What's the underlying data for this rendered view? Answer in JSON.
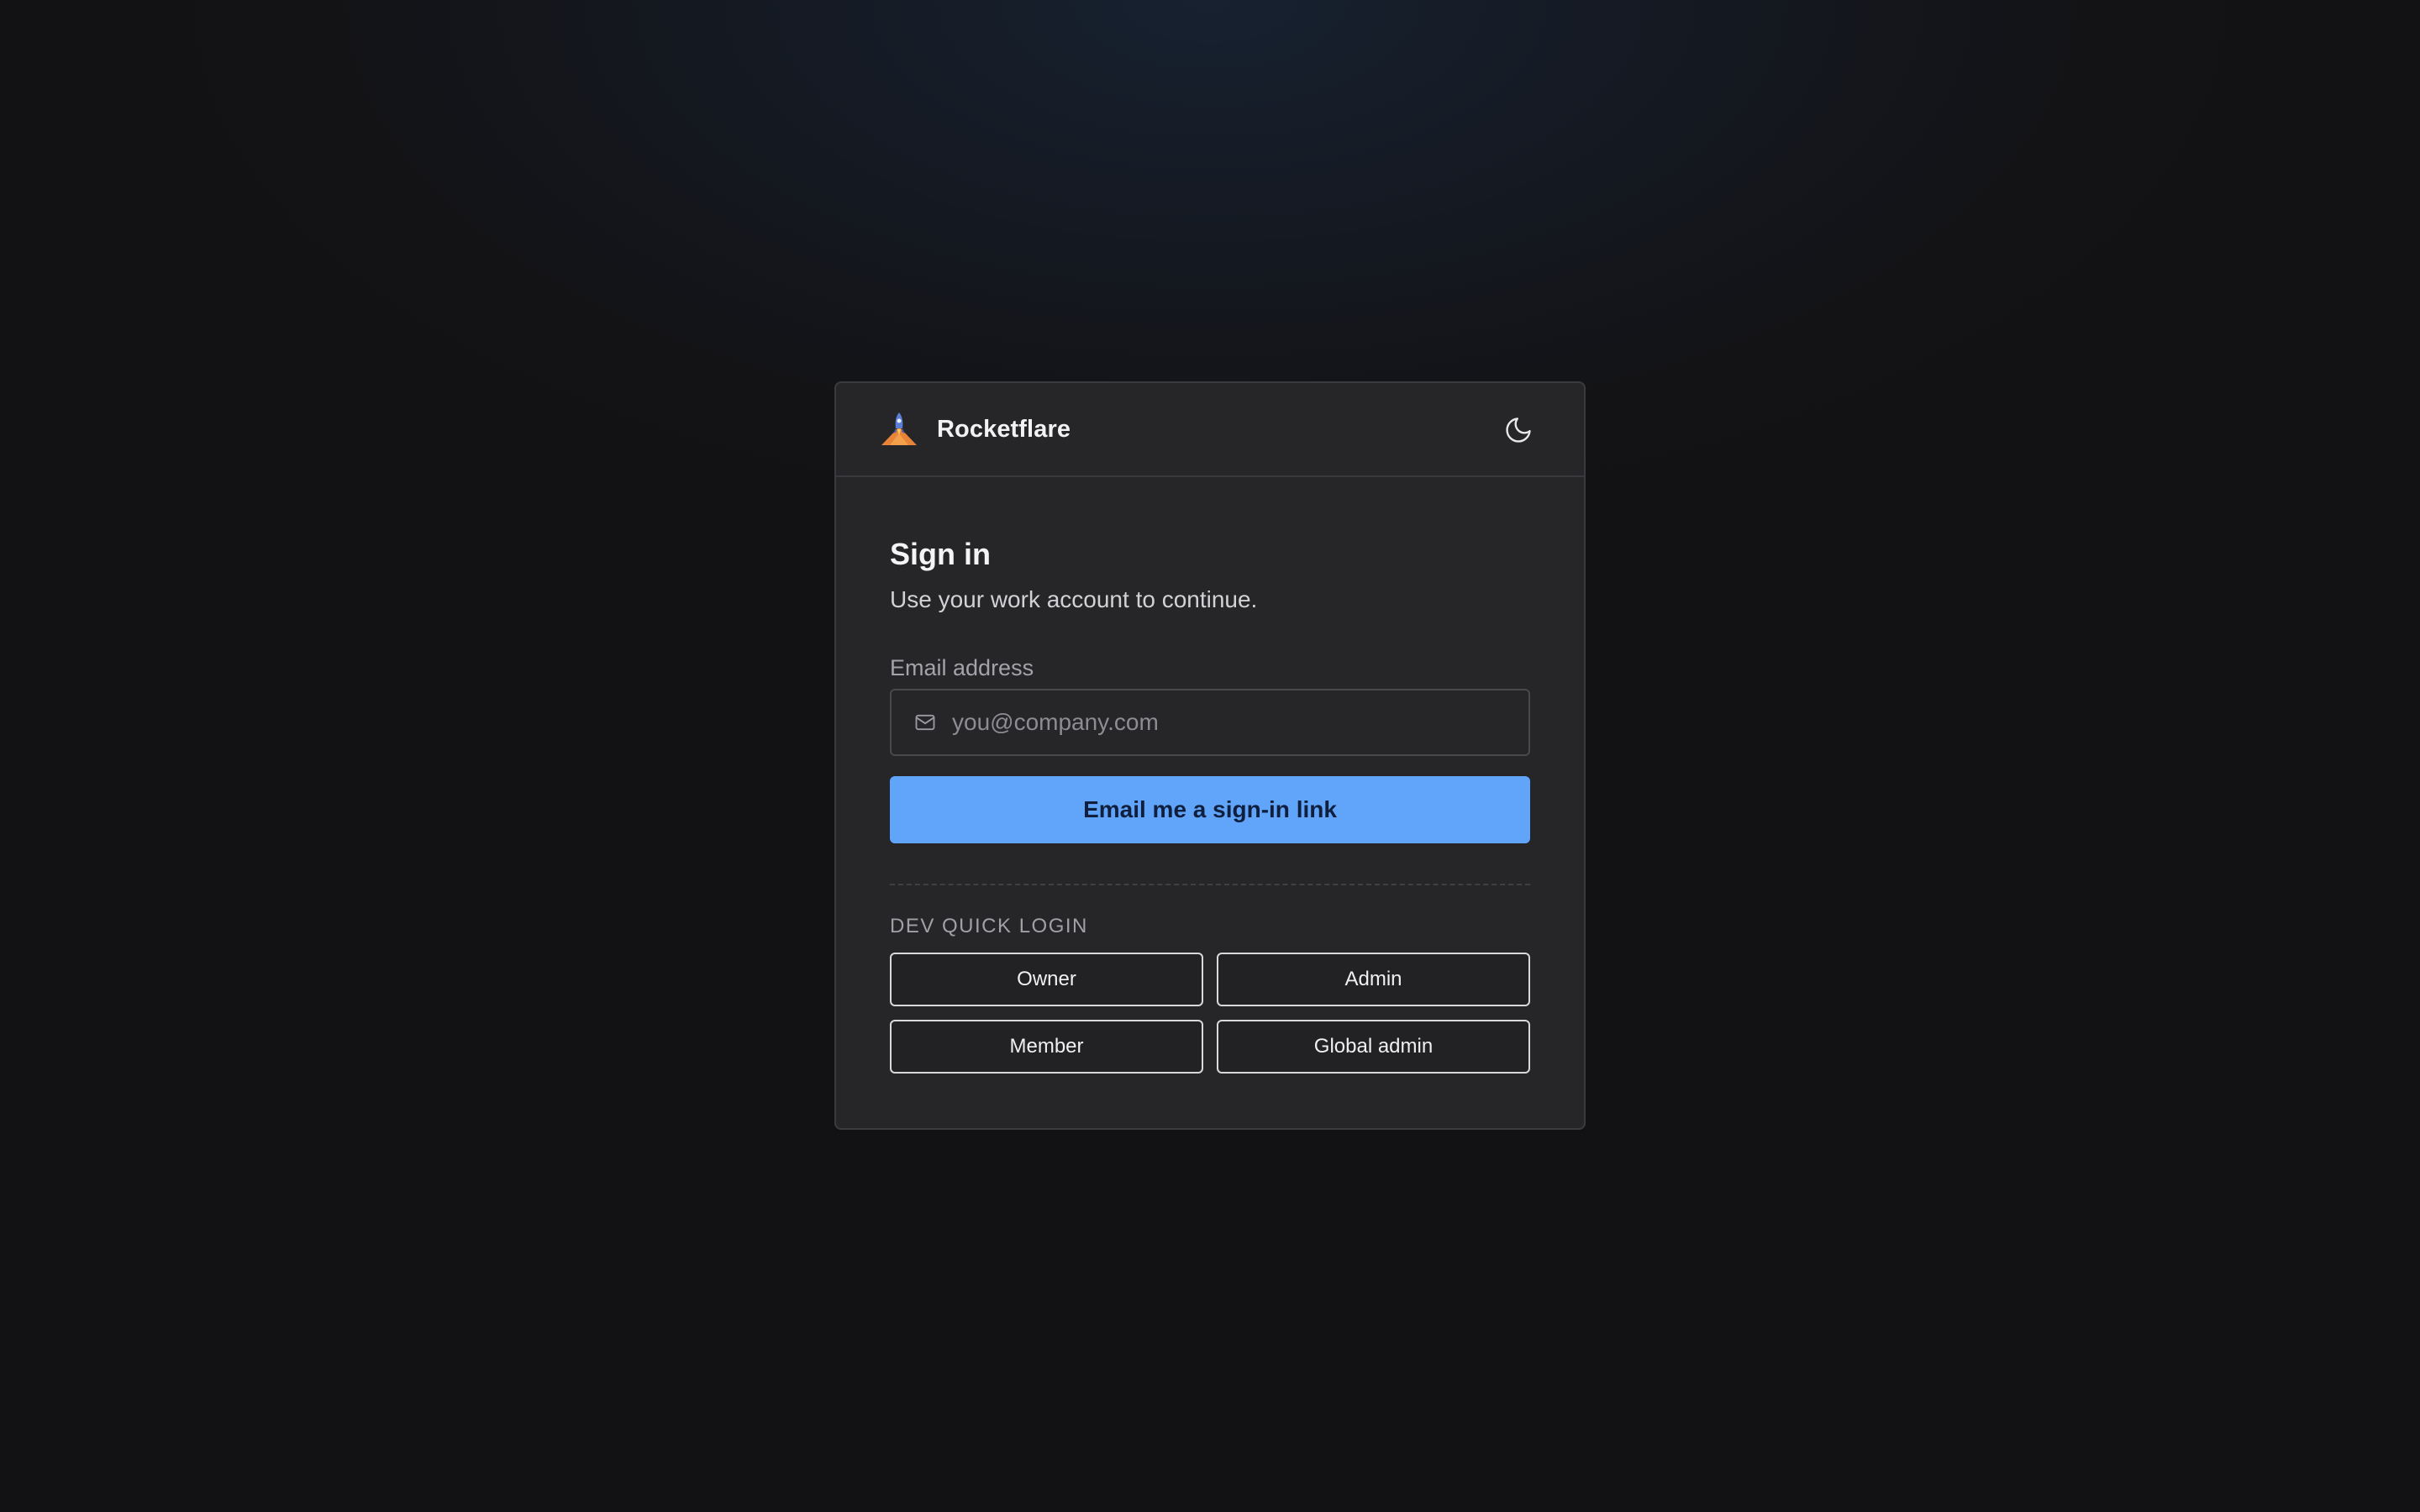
{
  "app": {
    "name": "Rocketflare",
    "logo_icon": "rocket-icon",
    "theme_toggle_icon": "moon-icon"
  },
  "signin": {
    "title": "Sign in",
    "subtitle": "Use your work account to continue.",
    "email_label": "Email address",
    "email_placeholder": "you@company.com",
    "email_value": "",
    "email_icon": "mail-icon",
    "submit_label": "Email me a sign-in link"
  },
  "dev_quick_login": {
    "label": "DEV QUICK LOGIN",
    "buttons": [
      {
        "label": "Owner"
      },
      {
        "label": "Admin"
      },
      {
        "label": "Member"
      },
      {
        "label": "Global admin"
      }
    ]
  },
  "colors": {
    "accent": "#60a5fa",
    "card_bg": "#262628",
    "page_bg": "#131316"
  }
}
